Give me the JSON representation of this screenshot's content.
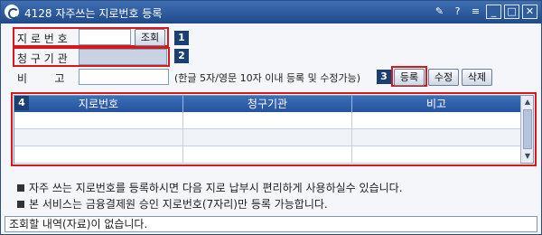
{
  "window": {
    "title": "4128 자주쓰는 지로번호 등록",
    "controls": [
      "pin-icon",
      "help-icon",
      "menu-icon",
      "minimize-icon",
      "maximize-icon",
      "close-icon"
    ]
  },
  "form": {
    "giro_label": "지 로 번 호",
    "giro_value": "",
    "lookup_button": "조회",
    "claim_label": "청 구 기 관",
    "claim_value": "",
    "note_label": "비        고",
    "note_value": "",
    "note_hint": "(한글 5자/영문 10자 이내 등록 및 수정가능)"
  },
  "badges": [
    "1",
    "2",
    "3",
    "4"
  ],
  "actions": {
    "register": "등록",
    "modify": "수정",
    "delete": "삭제"
  },
  "grid": {
    "columns": [
      "지로번호",
      "청구기관",
      "비고"
    ],
    "rows": [
      [
        "",
        "",
        ""
      ],
      [
        "",
        "",
        ""
      ],
      [
        "",
        "",
        ""
      ]
    ]
  },
  "notes": [
    "자주 쓰는 지로번호를 등록하시면 다음 지로 납부시 편리하게 사용하실수 있습니다.",
    "본 서비스는 금융결제원 승인 지로번호(7자리)만 등록 가능합니다."
  ],
  "status_message": "조회할 내역(자료)이 없습니다.",
  "colors": {
    "title_bar": "#1f4a8a",
    "highlight": "#d9181e",
    "grid_header": "#2453a0"
  }
}
